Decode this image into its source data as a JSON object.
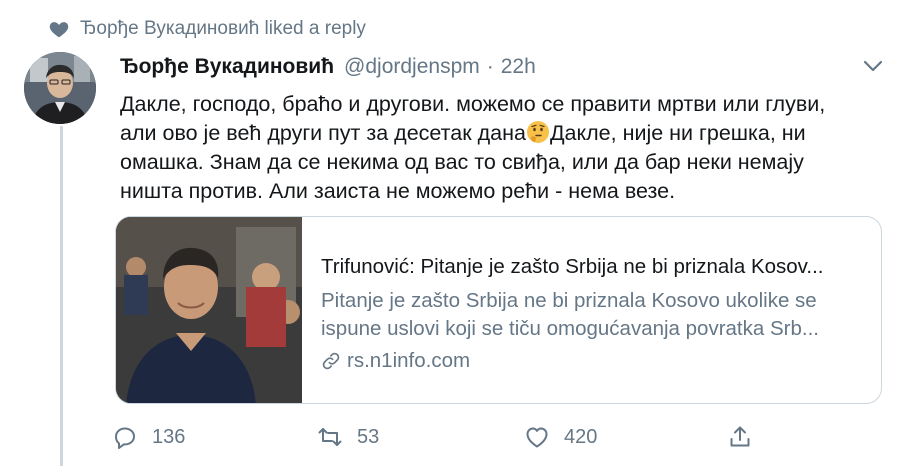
{
  "context": {
    "icon": "heart-icon",
    "text": "Ђорђе Вукадиновић liked a reply"
  },
  "tweet": {
    "author_name": "Ђорђе Вукадиновић",
    "handle": "@djordjenspm",
    "separator": "·",
    "time": "22h",
    "lines": [
      "Дакле, господо, браћо и другови. можемо се правити мртви или глуви,",
      "али ово је већ други пут за десетак дана",
      "Дакле, није ни грешка, ни",
      "омашка. Знам да се некима од вас то свиђа, или да бар неки немају",
      "ништа против. Али заиста не можемо рећи - нема везе."
    ],
    "emoji": "thinking-face"
  },
  "card": {
    "title": "Trifunović: Pitanje je zašto Srbija ne bi priznala Kosov...",
    "description_lines": [
      "Pitanje je zašto Srbija ne bi priznala Kosovo ukolike se",
      "ispune uslovi koji se tiču omogućavanja povratka Srb..."
    ],
    "domain": "rs.n1info.com"
  },
  "actions": {
    "reply_count": "136",
    "retweet_count": "53",
    "like_count": "420"
  },
  "colors": {
    "text_primary": "#14171a",
    "text_secondary": "#657786",
    "border": "#ccd6dd",
    "icon_muted": "#657786"
  }
}
